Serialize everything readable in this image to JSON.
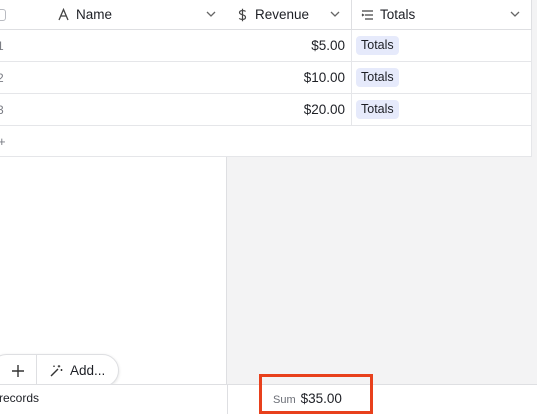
{
  "header": {
    "columns": [
      {
        "label": "Name",
        "icon": "text-field-icon"
      },
      {
        "label": "Revenue",
        "icon": "currency-icon"
      },
      {
        "label": "Totals",
        "icon": "rollup-icon"
      }
    ]
  },
  "rows": [
    {
      "num": "1",
      "revenue": "$5.00",
      "totals": "Totals"
    },
    {
      "num": "2",
      "revenue": "$10.00",
      "totals": "Totals"
    },
    {
      "num": "3",
      "revenue": "$20.00",
      "totals": "Totals"
    }
  ],
  "add_row": {
    "mark": "+"
  },
  "toolbar": {
    "add_label": "Add..."
  },
  "footer": {
    "records_label": "records",
    "sum_label": "Sum",
    "sum_value": "$35.00"
  },
  "colors": {
    "highlight": "#e8401c",
    "pill_bg": "#e6eafb",
    "grid_bg": "#f3f3f4"
  }
}
